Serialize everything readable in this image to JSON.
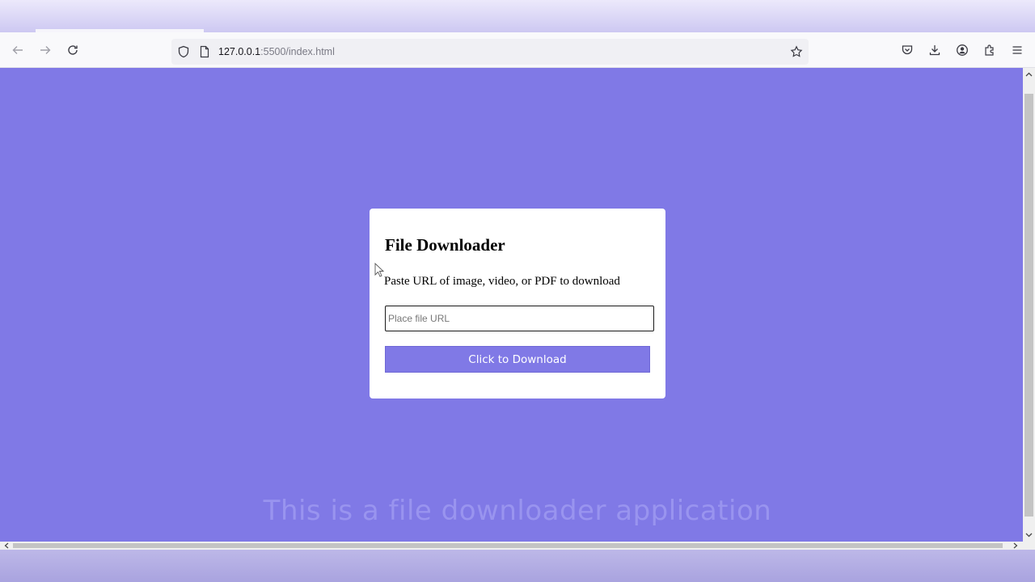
{
  "browser": {
    "url_host": "127.0.0.1",
    "url_path": ":5500/index.html",
    "icons": [
      "back-arrow-icon",
      "forward-arrow-icon",
      "reload-icon",
      "shield-icon",
      "page-icon",
      "bookmark-star-icon",
      "pocket-icon",
      "download-icon",
      "account-icon",
      "extensions-icon",
      "menu-icon"
    ]
  },
  "page": {
    "background_color": "#8079e6",
    "card": {
      "title": "File Downloader",
      "description": "Paste URL of image, video, or PDF to download",
      "input_placeholder": "Place file URL",
      "input_value": "",
      "button_label": "Click to Download"
    },
    "footer_text": "This is a  file downloader application"
  }
}
